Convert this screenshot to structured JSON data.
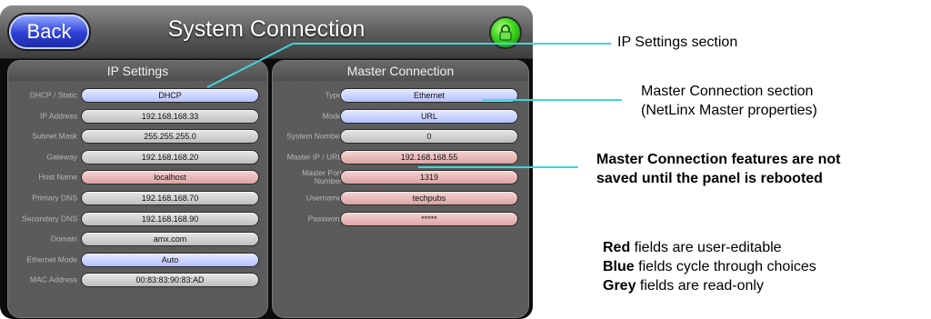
{
  "titlebar": {
    "back_label": "Back",
    "title": "System Connection"
  },
  "ip_settings": {
    "heading": "IP Settings",
    "rows": [
      {
        "label": "DHCP / Static",
        "value": "DHCP",
        "type": "blue"
      },
      {
        "label": "IP Address",
        "value": "192.168.168.33",
        "type": "grey"
      },
      {
        "label": "Subnet Mask",
        "value": "255.255.255.0",
        "type": "grey"
      },
      {
        "label": "Gateway",
        "value": "192.168.168.20",
        "type": "grey"
      },
      {
        "label": "Host Name",
        "value": "localhost",
        "type": "red"
      },
      {
        "label": "Primary DNS",
        "value": "192.168.168.70",
        "type": "grey"
      },
      {
        "label": "Secondary DNS",
        "value": "192.168.168.90",
        "type": "grey"
      },
      {
        "label": "Domain",
        "value": "amx.com",
        "type": "grey"
      },
      {
        "label": "Ethernet Mode",
        "value": "Auto",
        "type": "blue"
      },
      {
        "label": "MAC Address",
        "value": "00:83:83:90:83:AD",
        "type": "grey"
      }
    ]
  },
  "master_connection": {
    "heading": "Master Connection",
    "rows": [
      {
        "label": "Type",
        "value": "Ethernet",
        "type": "blue"
      },
      {
        "label": "Mode",
        "value": "URL",
        "type": "blue"
      },
      {
        "label": "System Number",
        "value": "0",
        "type": "grey"
      },
      {
        "label": "Master IP / URL",
        "value": "192.168.168.55",
        "type": "red"
      },
      {
        "label": "Master Port Number",
        "value": "1319",
        "type": "red"
      },
      {
        "label": "Username",
        "value": "techpubs",
        "type": "red"
      },
      {
        "label": "Password",
        "value": "*****",
        "type": "red"
      }
    ]
  },
  "callouts": {
    "ip_section": "IP Settings section",
    "master_section_line1": "Master Connection section",
    "master_section_line2": "(NetLinx Master properties)",
    "reboot_line1": "Master Connection features are not",
    "reboot_line2": "saved until the panel is rebooted"
  },
  "legend": {
    "red_word": "Red",
    "red_rest": " fields are user-editable",
    "blue_word": "Blue",
    "blue_rest": " fields cycle through choices",
    "grey_word": "Grey",
    "grey_rest": " fields are read-only"
  },
  "colors": {
    "callout_line": "#3fd6dc",
    "blue_field": "#b4c0ff",
    "grey_field": "#bdbdbd",
    "red_field": "#dca4a4",
    "lock_button": "#3bd61c"
  },
  "icons": {
    "lock": "lock-icon"
  }
}
